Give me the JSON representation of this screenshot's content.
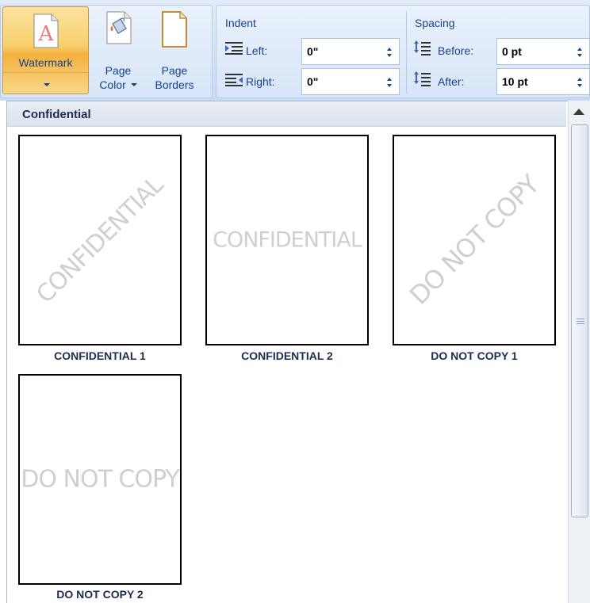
{
  "ribbon": {
    "buttons": {
      "watermark": "Watermark",
      "page_color_line1": "Page",
      "page_color_line2": "Color",
      "page_borders_line1": "Page",
      "page_borders_line2": "Borders"
    },
    "indent": {
      "title": "Indent",
      "left_label": "Left:",
      "left_value": "0\"",
      "right_label": "Right:",
      "right_value": "0\""
    },
    "spacing": {
      "title": "Spacing",
      "before_label": "Before:",
      "before_value": "0 pt",
      "after_label": "After:",
      "after_value": "10 pt"
    }
  },
  "gallery": {
    "category": "Confidential",
    "items": [
      {
        "watermark": "CONFIDENTIAL",
        "caption": "CONFIDENTIAL 1",
        "orientation": "diagonal"
      },
      {
        "watermark": "CONFIDENTIAL",
        "caption": "CONFIDENTIAL 2",
        "orientation": "horizontal"
      },
      {
        "watermark": "DO NOT COPY",
        "caption": "DO NOT COPY 1",
        "orientation": "diagonal"
      },
      {
        "watermark": "DO NOT COPY",
        "caption": "DO NOT COPY 2",
        "orientation": "horizontal"
      }
    ]
  },
  "colors": {
    "ribbon_text": "#15428b",
    "watermark_text": "#cfcfcf",
    "selected_button": "#f8cf6d"
  }
}
